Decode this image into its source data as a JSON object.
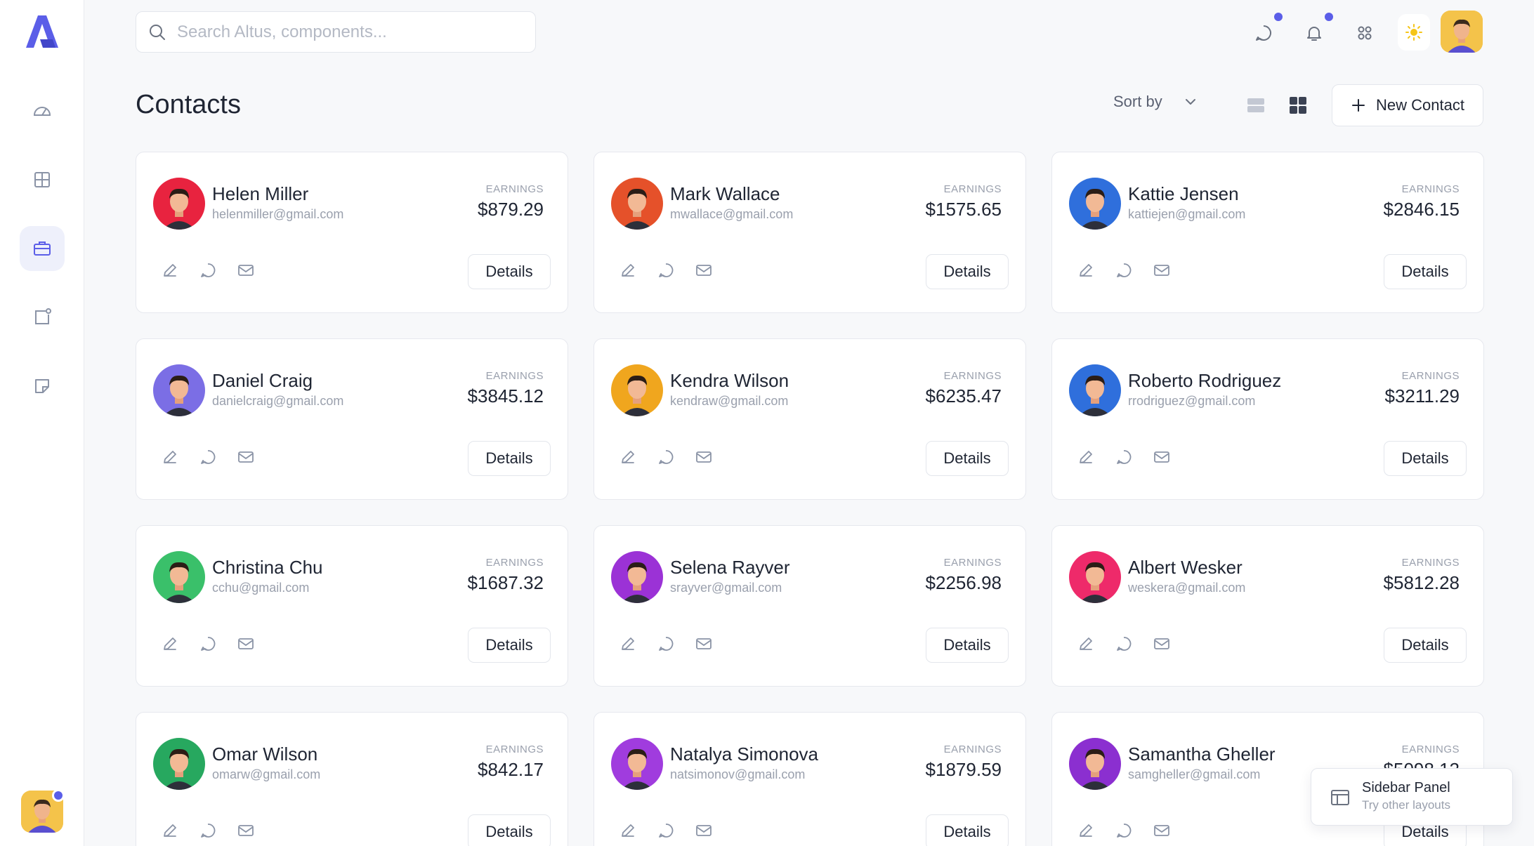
{
  "app": {
    "logo_letter": "A"
  },
  "search": {
    "placeholder": "Search Altus, components..."
  },
  "header": {
    "title": "Contacts",
    "sort_label": "Sort by",
    "new_contact_label": "New Contact"
  },
  "colors": {
    "accent": "#5b5ee8",
    "sun": "#f5c518"
  },
  "contacts": [
    {
      "name": "Helen Miller",
      "email": "helenmiller@gmail.com",
      "earnings_label": "EARNINGS",
      "earnings": "$879.29",
      "details_label": "Details",
      "avatar_bg": "#e8233f"
    },
    {
      "name": "Mark Wallace",
      "email": "mwallace@gmail.com",
      "earnings_label": "EARNINGS",
      "earnings": "$1575.65",
      "details_label": "Details",
      "avatar_bg": "#e5512a"
    },
    {
      "name": "Kattie Jensen",
      "email": "kattiejen@gmail.com",
      "earnings_label": "EARNINGS",
      "earnings": "$2846.15",
      "details_label": "Details",
      "avatar_bg": "#2f6fdc"
    },
    {
      "name": "Daniel Craig",
      "email": "danielcraig@gmail.com",
      "earnings_label": "EARNINGS",
      "earnings": "$3845.12",
      "details_label": "Details",
      "avatar_bg": "#7b6ee5"
    },
    {
      "name": "Kendra Wilson",
      "email": "kendraw@gmail.com",
      "earnings_label": "EARNINGS",
      "earnings": "$6235.47",
      "details_label": "Details",
      "avatar_bg": "#f0a61e"
    },
    {
      "name": "Roberto Rodriguez",
      "email": "rrodriguez@gmail.com",
      "earnings_label": "EARNINGS",
      "earnings": "$3211.29",
      "details_label": "Details",
      "avatar_bg": "#2f6fdc"
    },
    {
      "name": "Christina Chu",
      "email": "cchu@gmail.com",
      "earnings_label": "EARNINGS",
      "earnings": "$1687.32",
      "details_label": "Details",
      "avatar_bg": "#3ac06a"
    },
    {
      "name": "Selena Rayver",
      "email": "srayver@gmail.com",
      "earnings_label": "EARNINGS",
      "earnings": "$2256.98",
      "details_label": "Details",
      "avatar_bg": "#9b32d6"
    },
    {
      "name": "Albert Wesker",
      "email": "weskera@gmail.com",
      "earnings_label": "EARNINGS",
      "earnings": "$5812.28",
      "details_label": "Details",
      "avatar_bg": "#ee2a6a"
    },
    {
      "name": "Omar Wilson",
      "email": "omarw@gmail.com",
      "earnings_label": "EARNINGS",
      "earnings": "$842.17",
      "details_label": "Details",
      "avatar_bg": "#27a85f"
    },
    {
      "name": "Natalya Simonova",
      "email": "natsimonov@gmail.com",
      "earnings_label": "EARNINGS",
      "earnings": "$1879.59",
      "details_label": "Details",
      "avatar_bg": "#a03cde"
    },
    {
      "name": "Samantha Gheller",
      "email": "samgheller@gmail.com",
      "earnings_label": "EARNINGS",
      "earnings": "$5098.12",
      "details_label": "Details",
      "avatar_bg": "#8b2fd0"
    }
  ],
  "sidebar_panel": {
    "title": "Sidebar Panel",
    "subtitle": "Try other layouts"
  },
  "icons": {
    "nav": [
      "gauge-icon",
      "grid-icon",
      "briefcase-icon",
      "notification-square-icon",
      "sticker-icon"
    ],
    "top": [
      "chat-icon",
      "bell-icon",
      "apps-icon",
      "sun-icon"
    ],
    "card_actions": [
      "edit-icon",
      "message-icon",
      "mail-icon"
    ]
  }
}
